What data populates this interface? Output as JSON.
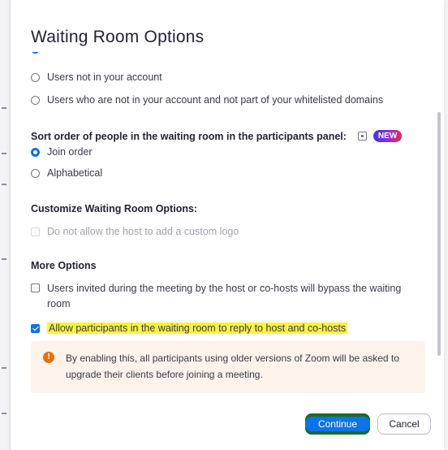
{
  "dialog": {
    "title": "Waiting Room Options"
  },
  "who_goes": {
    "options": [
      {
        "label": "Users not in your account",
        "selected": false
      },
      {
        "label": "Users who are not in your account and not part of your whitelisted domains",
        "selected": false
      }
    ]
  },
  "sort_order": {
    "heading": "Sort order of people in the waiting room in the participants panel:",
    "badge": "NEW",
    "options": [
      {
        "label": "Join order",
        "selected": true
      },
      {
        "label": "Alphabetical",
        "selected": false
      }
    ]
  },
  "customize": {
    "heading": "Customize Waiting Room Options:",
    "options": [
      {
        "label": "Do not allow the host to add a custom logo",
        "checked": false,
        "disabled": true
      }
    ]
  },
  "more_options": {
    "heading": "More Options",
    "options": [
      {
        "label": "Users invited during the meeting by the host or co-hosts will bypass the waiting room",
        "checked": false
      },
      {
        "label": "Allow participants in the waiting room to reply to host and co-hosts",
        "checked": true,
        "highlighted": true
      }
    ]
  },
  "notice": {
    "text": "By enabling this, all participants using older versions of Zoom will be asked to upgrade their clients before joining a meeting."
  },
  "footer": {
    "continue_label": "Continue",
    "cancel_label": "Cancel"
  },
  "colors": {
    "accent": "#0e72ed",
    "warning": "#e8710a",
    "highlight": "#f8f43d"
  }
}
